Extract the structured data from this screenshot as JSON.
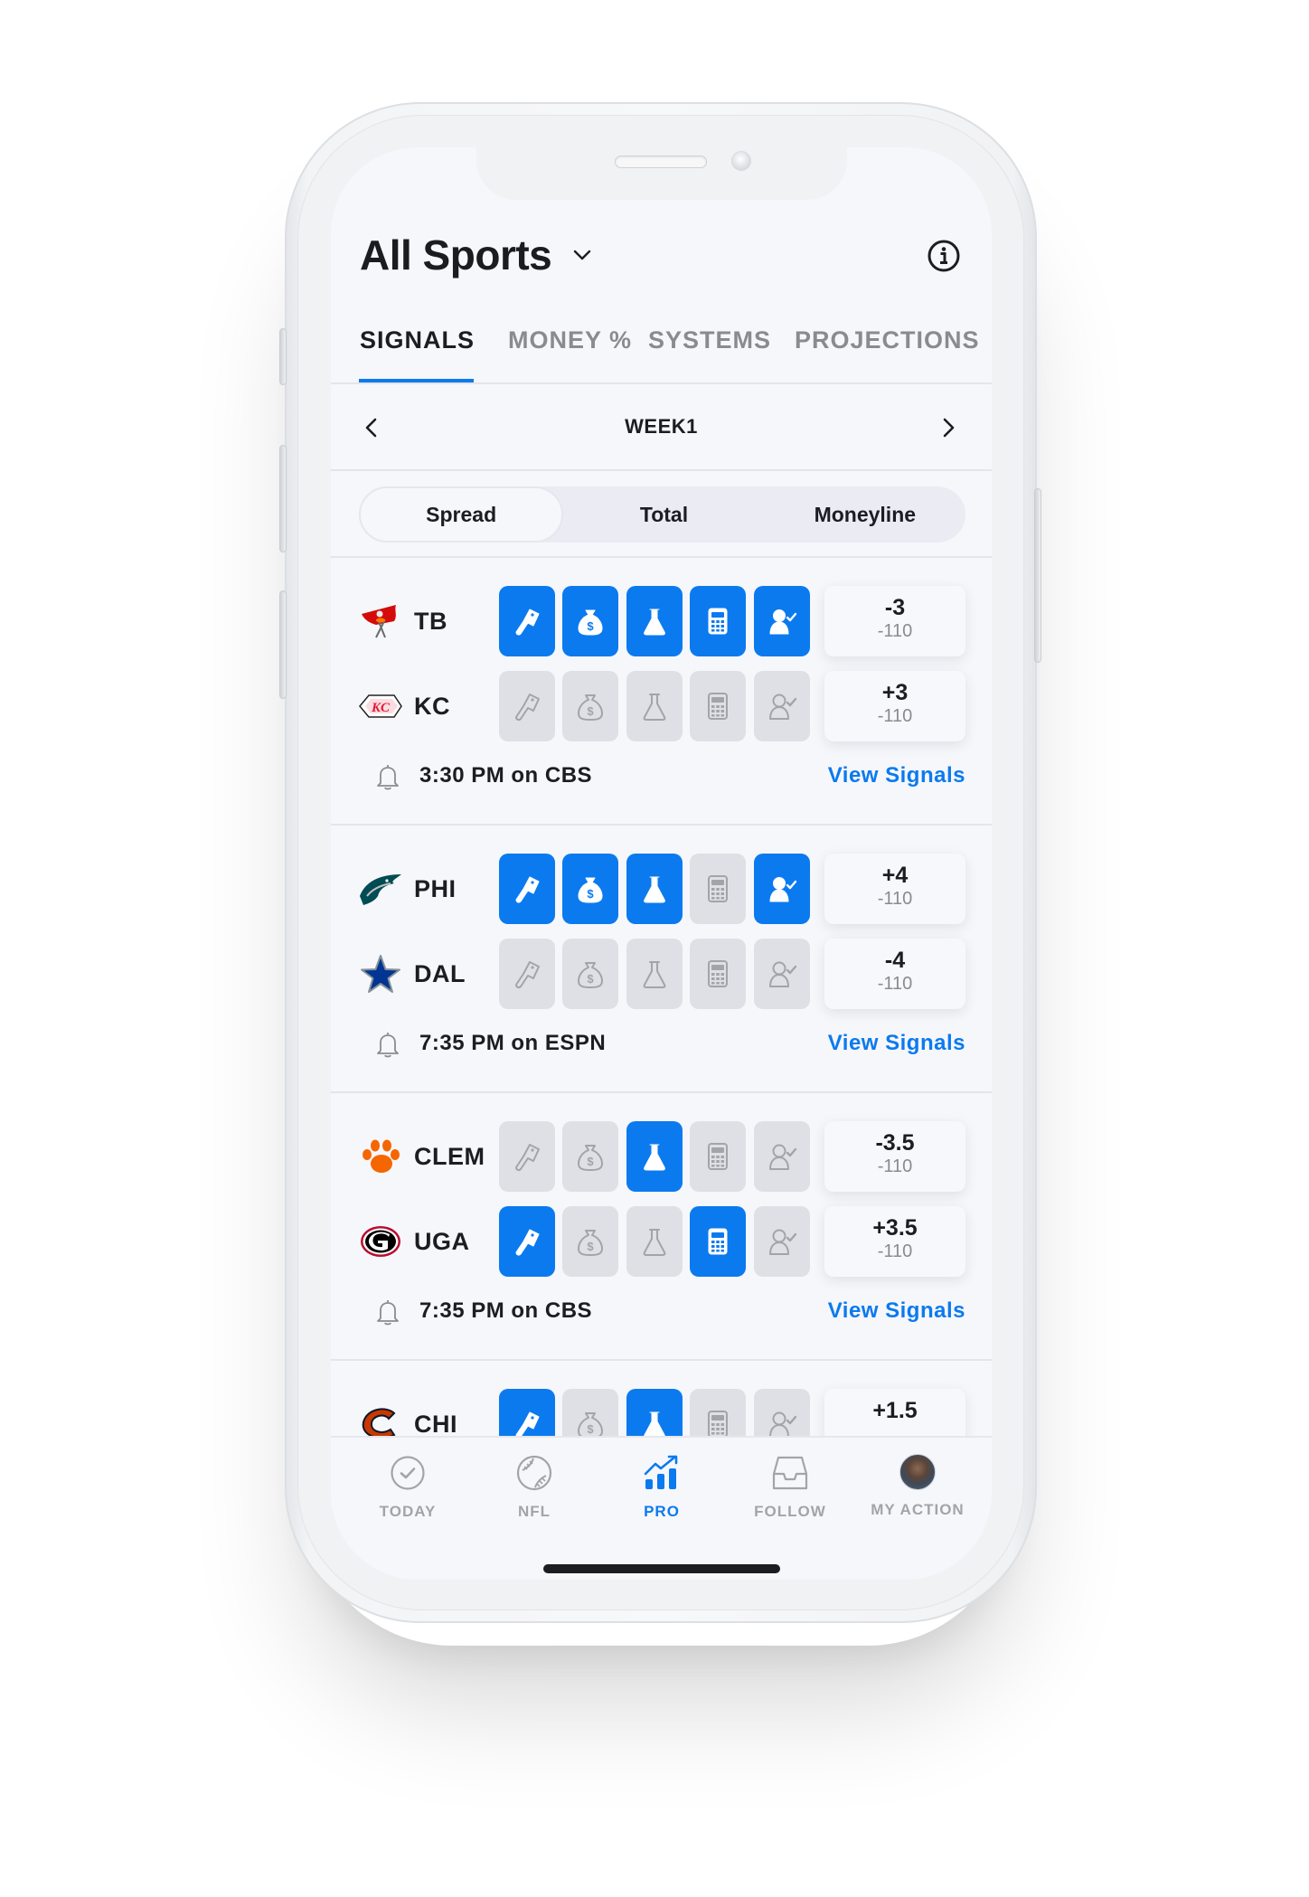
{
  "header": {
    "title": "All Sports",
    "title_dropdown_icon": "chevron-down-icon",
    "info_icon": "info-icon"
  },
  "tabs": [
    {
      "label": "SIGNALS",
      "active": true
    },
    {
      "label": "MONEY %",
      "active": false
    },
    {
      "label": "SYSTEMS",
      "active": false
    },
    {
      "label": "PROJECTIONS",
      "active": false
    }
  ],
  "week": {
    "label": "WEEK1",
    "prev_icon": "chevron-left-icon",
    "next_icon": "chevron-right-icon"
  },
  "bet_types": [
    {
      "label": "Spread",
      "selected": true
    },
    {
      "label": "Total",
      "selected": false
    },
    {
      "label": "Moneyline",
      "selected": false
    }
  ],
  "signal_types": [
    "sharp-action-cleaver-icon",
    "big-money-bag-icon",
    "pro-system-flask-icon",
    "model-calculator-icon",
    "expert-pick-person-check-icon"
  ],
  "games": [
    {
      "teams": [
        {
          "abbr": "TB",
          "logo": "buccaneers-flag-logo",
          "signals": [
            true,
            true,
            true,
            true,
            true
          ],
          "line": "-3",
          "price": "-110"
        },
        {
          "abbr": "KC",
          "logo": "chiefs-arrowhead-logo",
          "signals": [
            false,
            false,
            false,
            false,
            false
          ],
          "line": "+3",
          "price": "-110"
        }
      ],
      "time": "3:30 PM on CBS",
      "link": "View Signals"
    },
    {
      "teams": [
        {
          "abbr": "PHI",
          "logo": "eagles-head-logo",
          "signals": [
            true,
            true,
            true,
            false,
            true
          ],
          "line": "+4",
          "price": "-110"
        },
        {
          "abbr": "DAL",
          "logo": "cowboys-star-logo",
          "signals": [
            false,
            false,
            false,
            false,
            false
          ],
          "line": "-4",
          "price": "-110"
        }
      ],
      "time": "7:35 PM on ESPN",
      "link": "View Signals"
    },
    {
      "teams": [
        {
          "abbr": "CLEM",
          "logo": "clemson-paw-logo",
          "signals": [
            false,
            false,
            true,
            false,
            false
          ],
          "line": "-3.5",
          "price": "-110"
        },
        {
          "abbr": "UGA",
          "logo": "georgia-g-logo",
          "signals": [
            true,
            false,
            false,
            true,
            false
          ],
          "line": "+3.5",
          "price": "-110"
        }
      ],
      "time": "7:35 PM on CBS",
      "link": "View Signals"
    },
    {
      "teams": [
        {
          "abbr": "CHI",
          "logo": "bears-c-logo",
          "signals": [
            true,
            false,
            true,
            false,
            false
          ],
          "line": "+1.5",
          "price": ""
        }
      ],
      "time": "",
      "link": ""
    }
  ],
  "tabbar": [
    {
      "label": "TODAY",
      "icon": "check-circle-icon",
      "active": false
    },
    {
      "label": "NFL",
      "icon": "ball-icon",
      "active": false
    },
    {
      "label": "PRO",
      "icon": "chart-growth-icon",
      "active": true
    },
    {
      "label": "FOLLOW",
      "icon": "inbox-tray-icon",
      "active": false
    },
    {
      "label": "MY ACTION",
      "icon": "avatar",
      "active": false
    }
  ],
  "colors": {
    "accent": "#0b7aef",
    "inactive_signal": "#dfe0e5",
    "background": "#f6f7fb",
    "text": "#1c1d22",
    "muted": "#8a8b91"
  }
}
